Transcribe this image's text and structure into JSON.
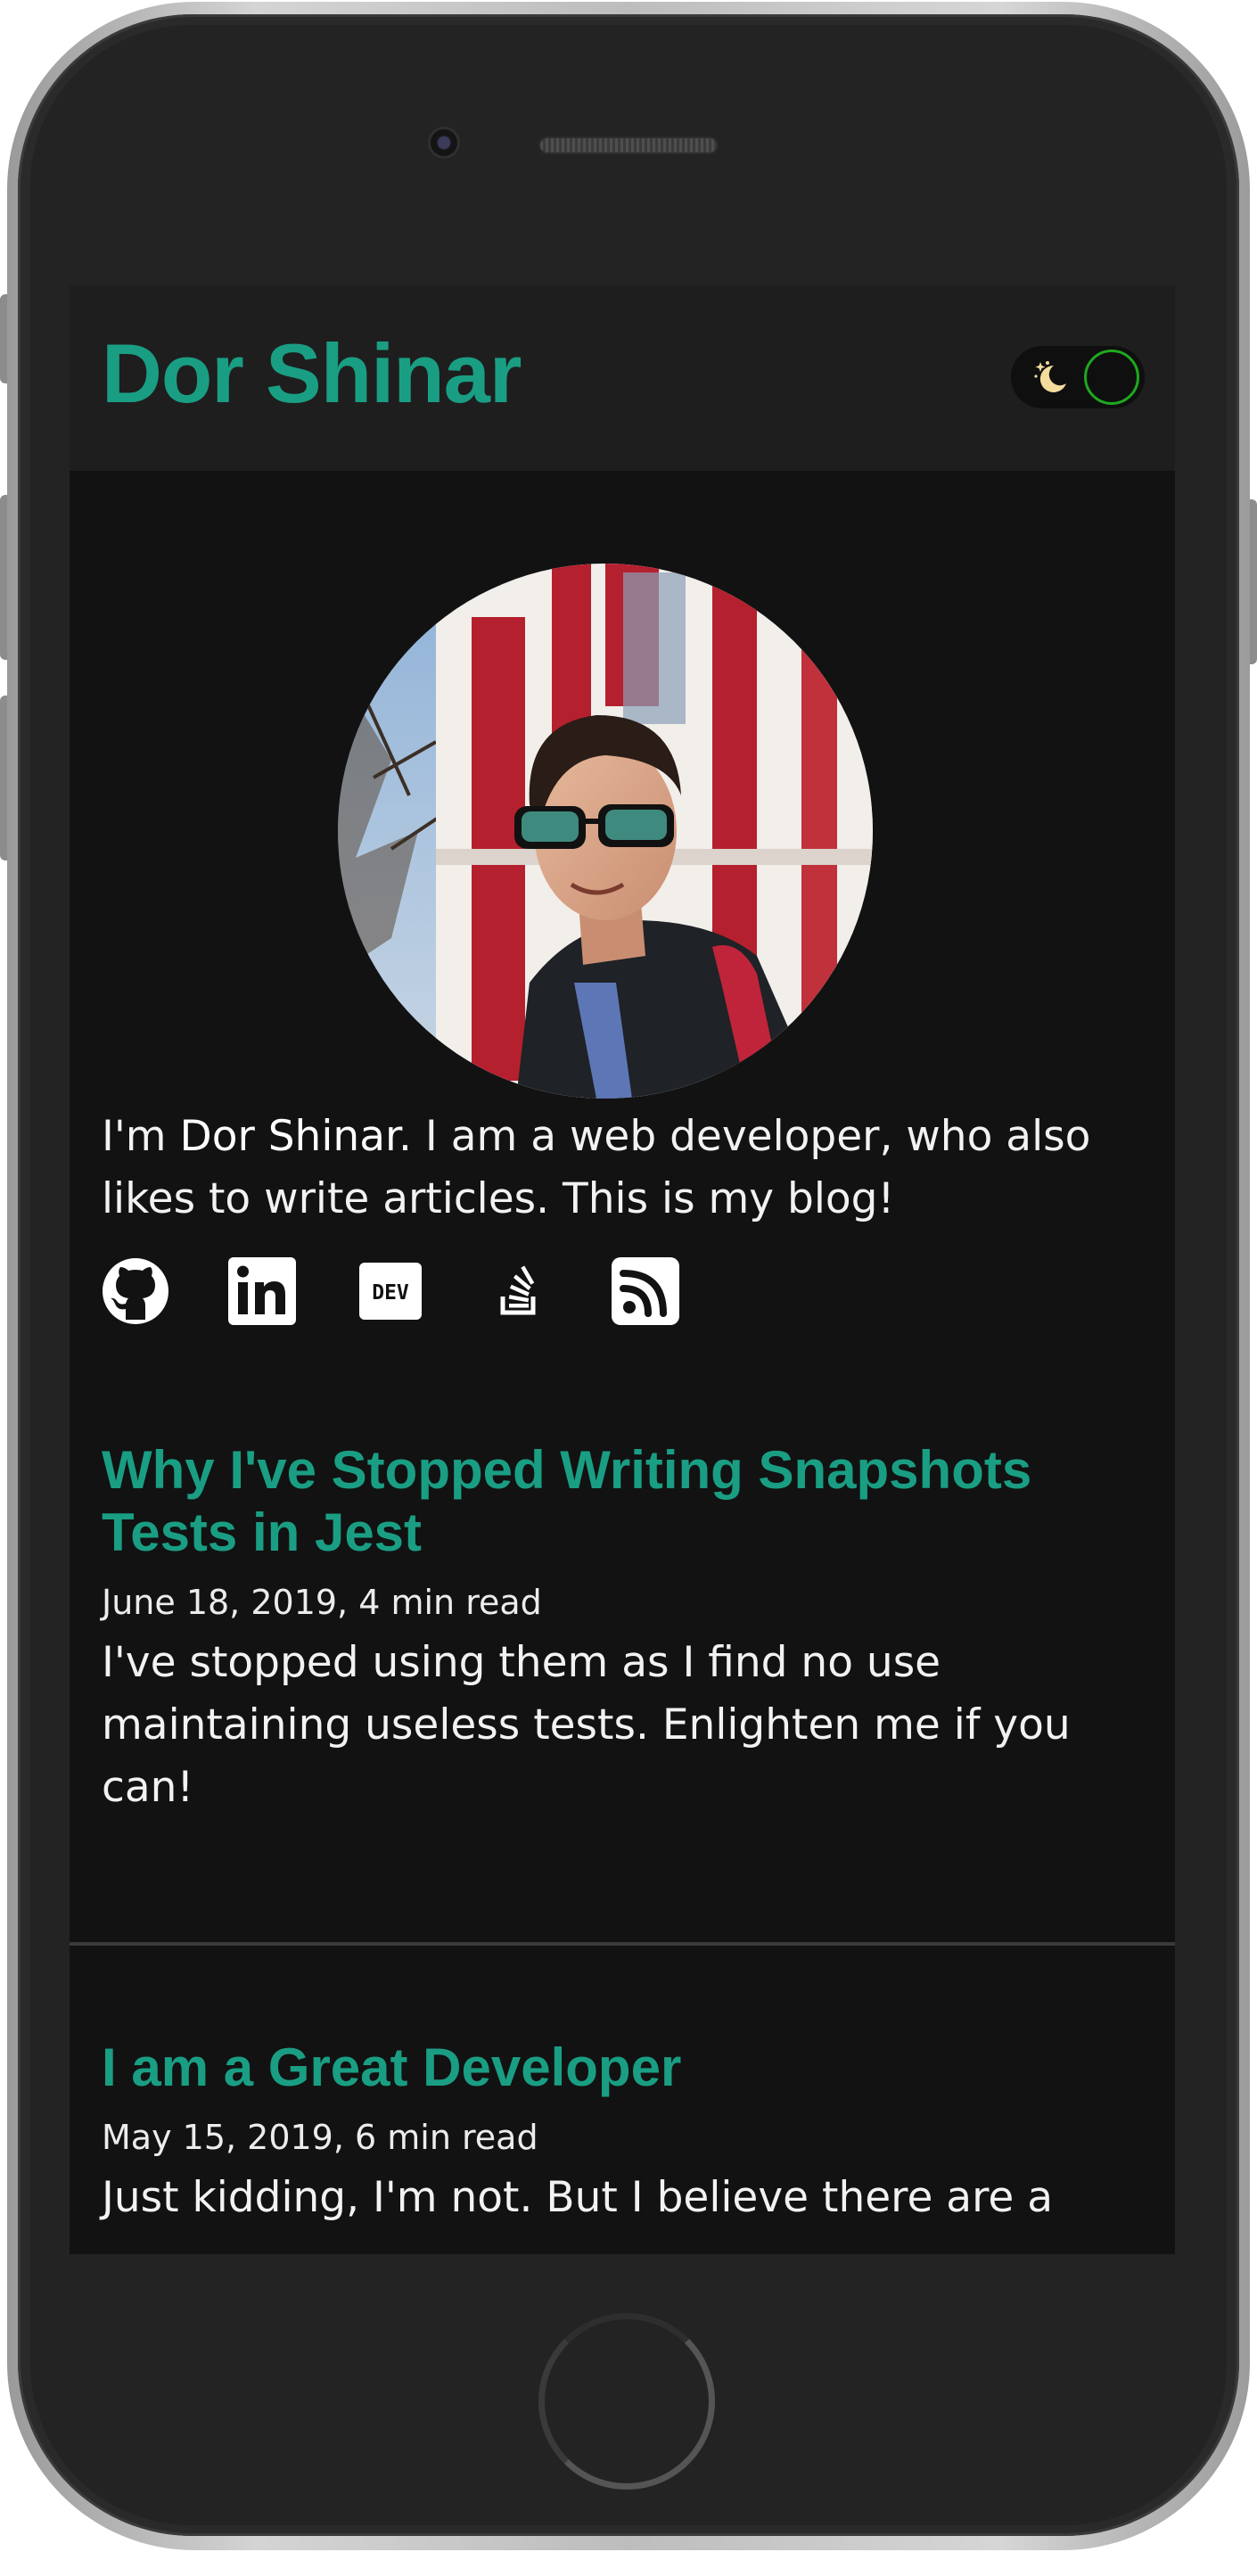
{
  "header": {
    "title": "Dor Shinar",
    "theme_toggle": {
      "mode": "dark",
      "icon": "moon-stars-icon"
    }
  },
  "bio": {
    "avatar_alt": "Profile photo",
    "intro_prefix": "I'm ",
    "name": "Dor Shinar",
    "intro_suffix": ". I am a web developer, who also likes to write articles. This is my blog!"
  },
  "social": [
    {
      "name": "github-icon"
    },
    {
      "name": "linkedin-icon"
    },
    {
      "name": "dev-to-icon",
      "label": "DEV"
    },
    {
      "name": "stackoverflow-icon"
    },
    {
      "name": "rss-icon"
    }
  ],
  "posts": [
    {
      "title": "Why I've Stopped Writing Snapshots Tests in Jest",
      "meta": "June 18, 2019, 4 min read",
      "excerpt": "I've stopped using them as I find no use maintaining useless tests. Enlighten me if you can!"
    },
    {
      "title": "I am a Great Developer",
      "meta": "May 15, 2019, 6 min read",
      "excerpt": "Just kidding, I'm not. But I believe there are a"
    }
  ],
  "colors": {
    "accent": "#1a9e83",
    "background": "#121212",
    "header_bg": "#1e1e1e",
    "toggle_ring": "#1ea81e",
    "text": "#f2f2f2"
  }
}
